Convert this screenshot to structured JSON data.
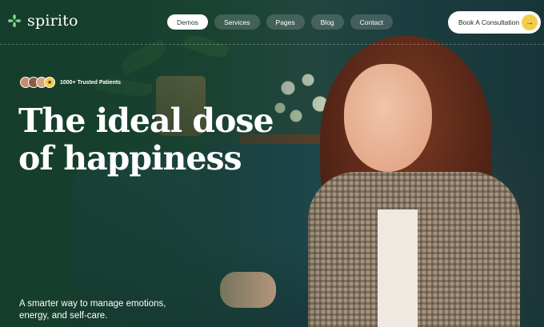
{
  "brand": {
    "name": "spirito",
    "logo_icon": "clover-icon",
    "accent_color": "#f2cd4b",
    "bg_color": "#1f4a38"
  },
  "nav": {
    "items": [
      {
        "label": "Demos",
        "active": true
      },
      {
        "label": "Services",
        "active": false
      },
      {
        "label": "Pages",
        "active": false
      },
      {
        "label": "Blog",
        "active": false
      },
      {
        "label": "Contact",
        "active": false
      }
    ]
  },
  "cta": {
    "label": "Book A Consultation",
    "icon": "arrow-right-icon"
  },
  "hero": {
    "trusted_label": "1000+ Trusted Patients",
    "headline_line1": "The ideal dose",
    "headline_line2": "of happiness",
    "subline_line1": "A smarter way to manage emotions,",
    "subline_line2": "energy, and self-care."
  }
}
